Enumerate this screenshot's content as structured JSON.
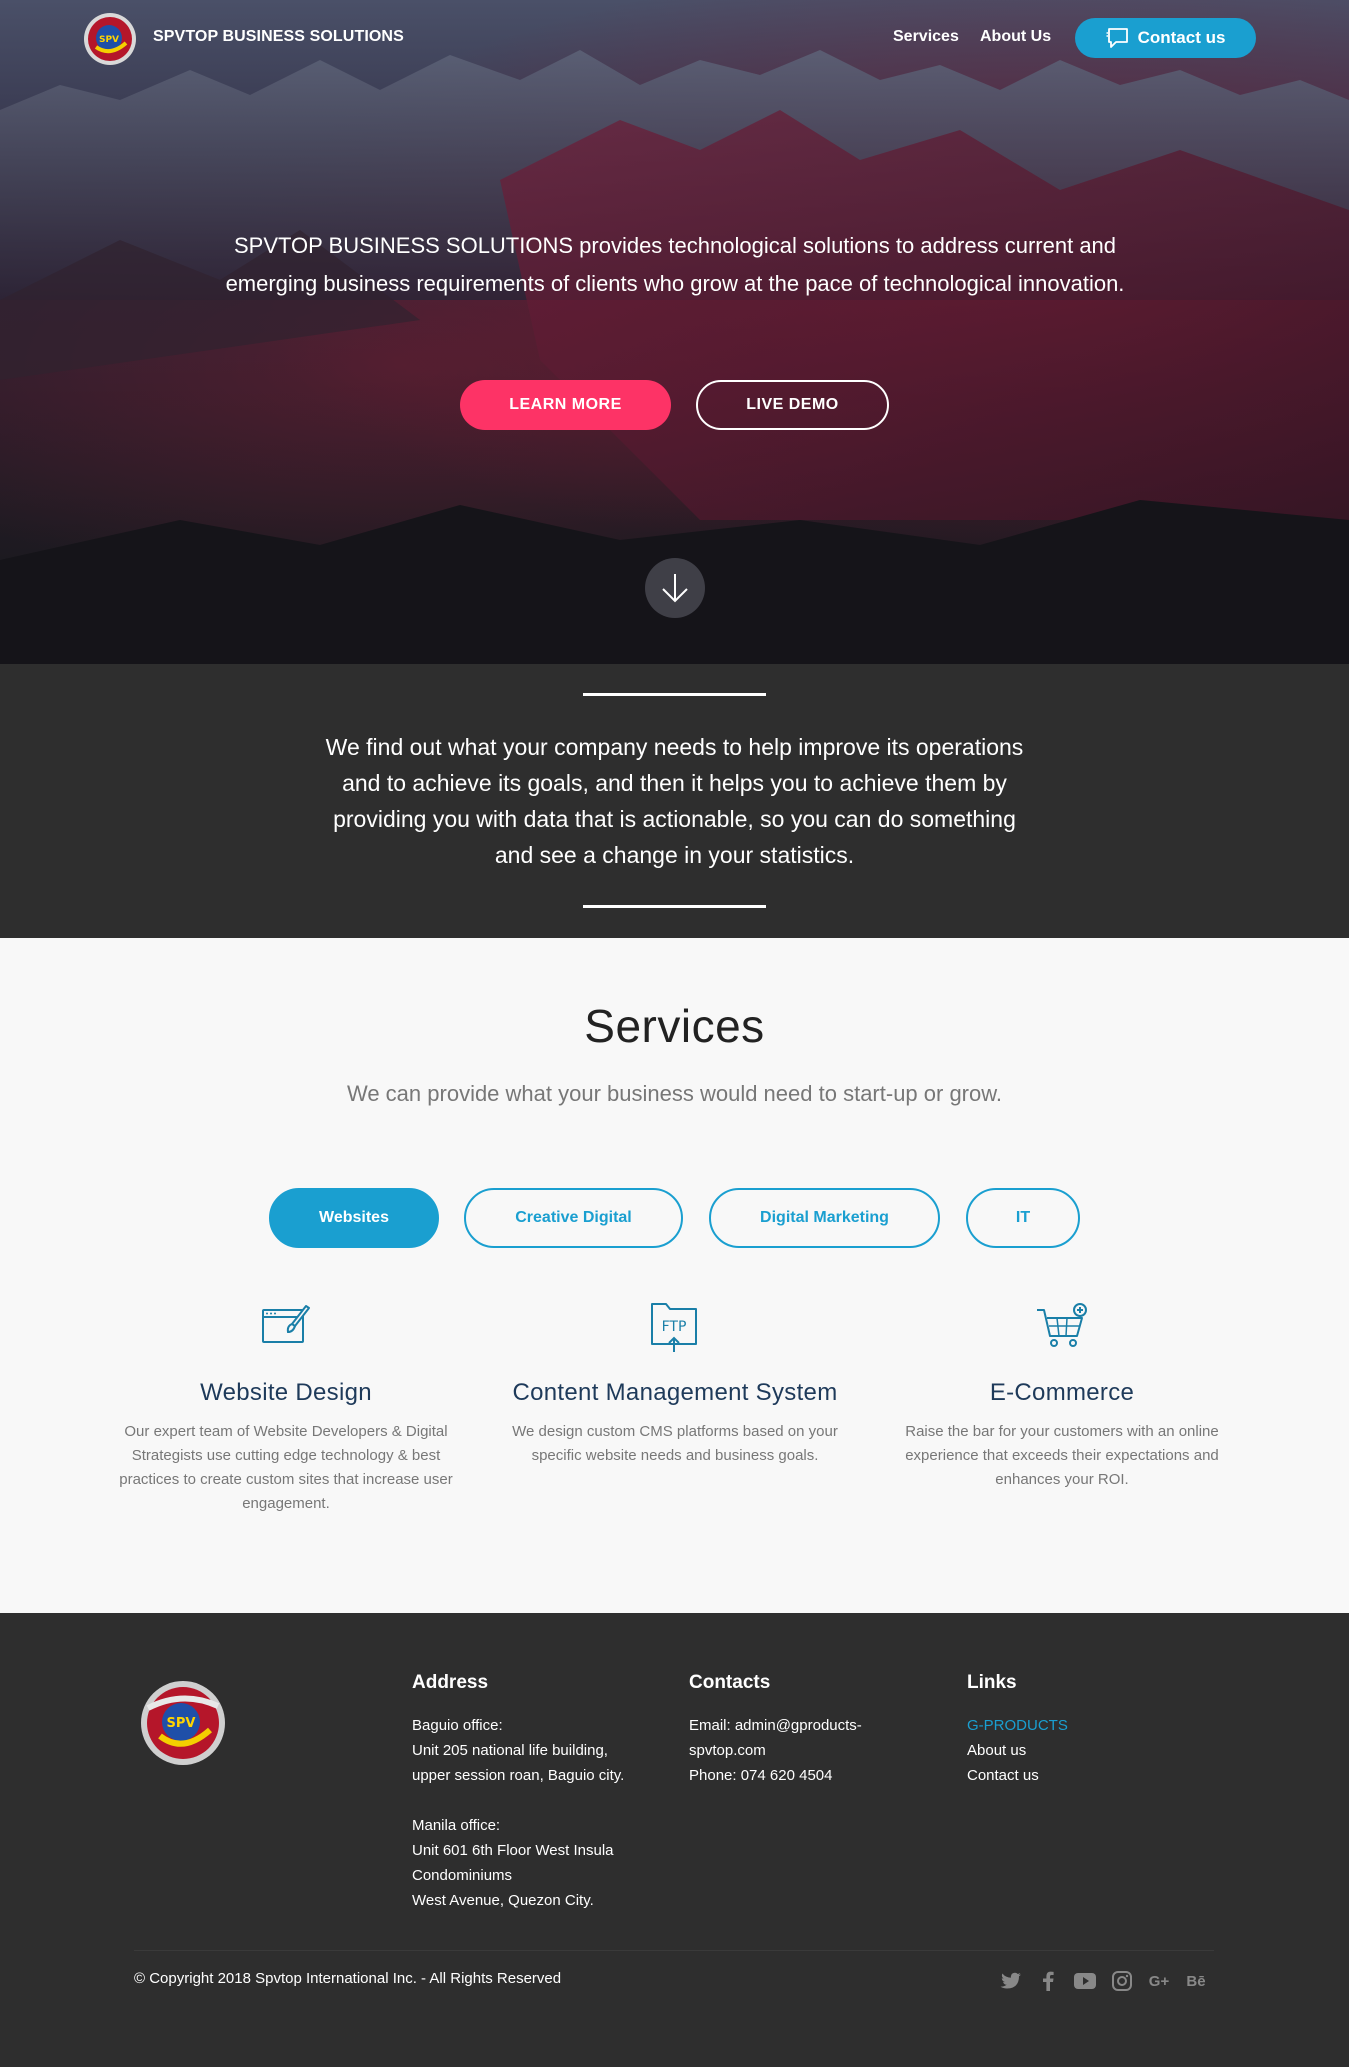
{
  "nav": {
    "brand": "SPVTOP BUSINESS SOLUTIONS",
    "links": [
      "Services",
      "About Us"
    ],
    "contact_label": "Contact us"
  },
  "hero": {
    "text": "SPVTOP BUSINESS SOLUTIONS provides technological solutions to address current and emerging business requirements of clients who grow at the pace of technological innovation.",
    "learn_more": "LEARN MORE",
    "live_demo": "LIVE DEMO"
  },
  "mission": {
    "text": "We find out what your company needs to help improve its operations and to achieve its goals, and then it helps you to achieve them by providing you with data that is actionable, so you can do something and see a change in your statistics."
  },
  "services": {
    "title": "Services",
    "subtitle": "We can provide what your business would need to start-up or grow.",
    "tabs": [
      "Websites",
      "Creative Digital",
      "Digital Marketing",
      "IT"
    ],
    "active_tab": "Websites",
    "cards": [
      {
        "icon": "web-design-icon",
        "title": "Website Design",
        "desc": "Our expert team of Website Developers & Digital Strategists use cutting edge technology & best practices to create custom sites that increase user engagement."
      },
      {
        "icon": "ftp-folder-icon",
        "title": "Content Management System",
        "desc": "We design custom CMS platforms based on your specific website needs and business goals."
      },
      {
        "icon": "shopping-cart-icon",
        "title": "E-Commerce",
        "desc": "Raise the bar for your customers with an online experience that exceeds their expectations and enhances your ROI."
      }
    ],
    "ftp_label": "FTP"
  },
  "footer": {
    "address": {
      "heading": "Address",
      "baguio_label": "Baguio office:",
      "baguio_line1": "Unit 205 national life building,",
      "baguio_line2": "upper session roan, Baguio city.",
      "manila_label": "Manila office:",
      "manila_line1": "Unit 601 6th Floor West Insula",
      "manila_line2": "Condominiums",
      "manila_line3": "West Avenue, Quezon City."
    },
    "contacts": {
      "heading": "Contacts",
      "email_line1": "Email: admin@gproducts-",
      "email_line2": "spvtop.com",
      "phone": "Phone: 074 620 4504"
    },
    "links": {
      "heading": "Links",
      "items": [
        "G-PRODUCTS",
        "About us",
        "Contact us"
      ]
    },
    "copyright": "© Copyright 2018 Spvtop International Inc. - All Rights Reserved",
    "social": [
      "twitter-icon",
      "facebook-icon",
      "youtube-icon",
      "instagram-icon",
      "google-plus-icon",
      "behance-icon"
    ],
    "social_glyphs": {
      "google_plus": "G+",
      "behance": "Bē"
    }
  },
  "colors": {
    "accent_blue": "#1a9fd0",
    "accent_pink": "#fd3366",
    "dark_bg": "#2e2e2e",
    "light_bg": "#f8f8f8",
    "card_title": "#1e3a5a"
  }
}
